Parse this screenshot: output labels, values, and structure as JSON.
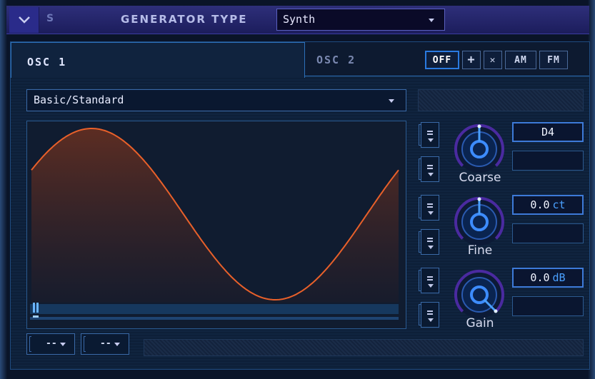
{
  "header": {
    "slot": "S",
    "title": "GENERATOR TYPE",
    "generator_type": "Synth"
  },
  "tabs": [
    {
      "label": "OSC 1",
      "active": true
    },
    {
      "label": "OSC 2",
      "active": false
    }
  ],
  "modulation_buttons": [
    {
      "label": "OFF",
      "active": true
    },
    {
      "label": "+",
      "active": false
    },
    {
      "label": "✕",
      "active": false
    },
    {
      "label": "AM",
      "active": false
    },
    {
      "label": "FM",
      "active": false
    }
  ],
  "waveform": {
    "preset": "Basic/Standard",
    "shape": "sine",
    "color": "#e8602a"
  },
  "controls": [
    {
      "label": "Coarse",
      "value": "D4",
      "unit": ""
    },
    {
      "label": "Fine",
      "value": "0.0",
      "unit": "ct"
    },
    {
      "label": "Gain",
      "value": "0.0",
      "unit": "dB"
    }
  ],
  "bottom_selectors": [
    {
      "value": "--"
    },
    {
      "value": "--"
    }
  ],
  "mod_slot_value": "--",
  "colors": {
    "accent": "#2a7ae0",
    "header": "#2e2f7a",
    "panel": "#0f2038"
  }
}
